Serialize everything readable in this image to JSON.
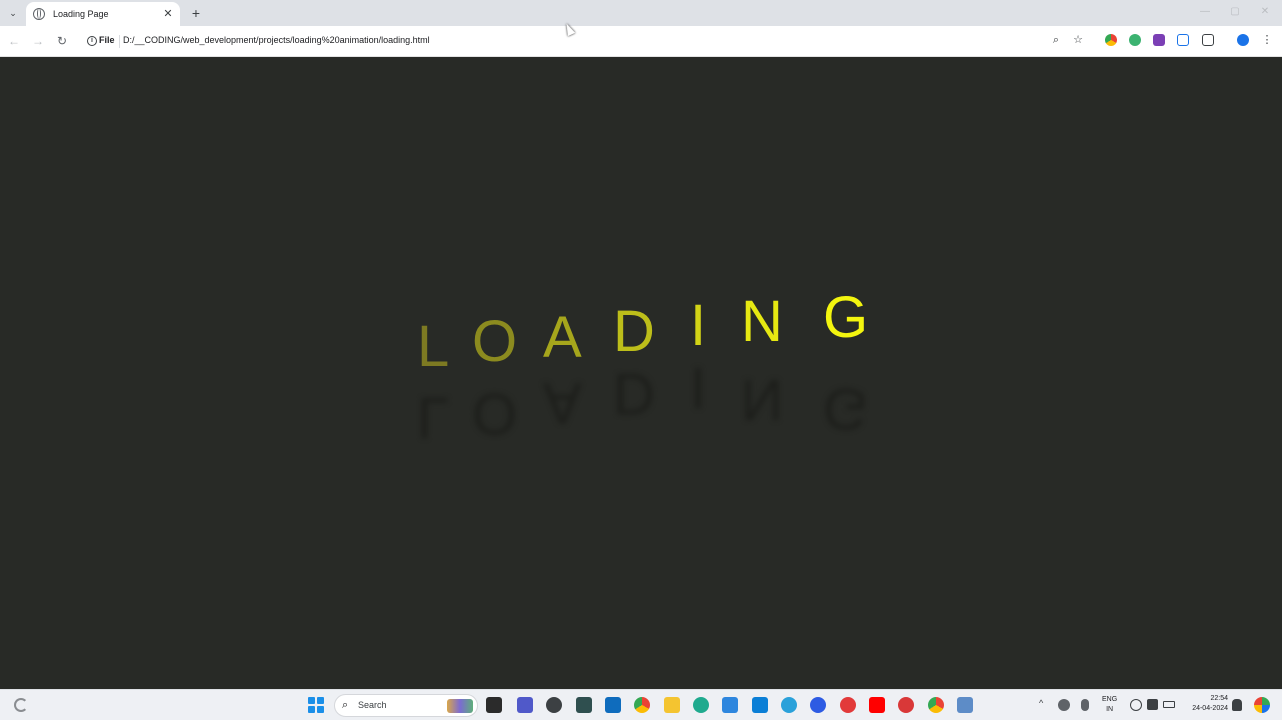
{
  "browser": {
    "tab_title": "Loading Page",
    "file_chip": "File",
    "url": "D:/__CODING/web_development/projects/loading%20animation/loading.html"
  },
  "page": {
    "letters": [
      "L",
      "O",
      "A",
      "D",
      "I",
      "N",
      "G"
    ],
    "letter_colors": [
      "#7d7a22",
      "#8c8b1f",
      "#a6a61c",
      "#bdbe1a",
      "#d3d416",
      "#e6e812",
      "#f3f50f"
    ]
  },
  "taskbar": {
    "search_label": "Search",
    "lang_line1": "ENG",
    "lang_line2": "IN",
    "time": "22:54",
    "date": "24-04-2024"
  },
  "icons": {
    "glyphs": {
      "back": "←",
      "forward": "→",
      "reload": "↻",
      "zoom": "⌕",
      "star": "☆",
      "menu": "⋮",
      "close": "✕",
      "plus": "+",
      "minimize": "—",
      "maximize": "▢",
      "tab_list": "⌄",
      "search": "⌕",
      "chevron_up": "^",
      "bell": "🔔"
    }
  }
}
